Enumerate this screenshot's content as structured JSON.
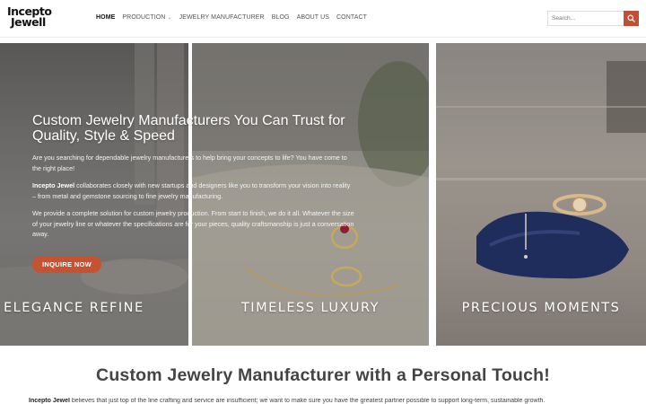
{
  "logo": {
    "line1": "Incepto",
    "line2": "Jewell"
  },
  "nav": {
    "items": [
      {
        "label": "HOME",
        "active": true
      },
      {
        "label": "PRODUCTION",
        "dropdown": true
      },
      {
        "label": "JEWELRY MANUFACTURER"
      },
      {
        "label": "BLOG"
      },
      {
        "label": "ABOUT US"
      },
      {
        "label": "CONTACT"
      }
    ]
  },
  "search": {
    "placeholder": "Search...",
    "icon": "search-icon",
    "button_color": "#c24f33"
  },
  "hero": {
    "title": "Custom Jewelry Manufacturers You Can Trust for Quality, Style & Speed",
    "p1": "Are you searching for dependable jewelry manufacturers to help bring your concepts to life? You have come to the right place!",
    "p2_brand": "Incepto Jewel",
    "p2_rest": " collaborates closely with new startups and designers like you to transform your vision into reality – from metal and gemstone sourcing to fine jewelry manufacturing.",
    "p3": "We provide a complete solution for custom jewelry production. From start to finish, we do it all. Whatever the size of your jewelry line or whatever the specifications are for your pieces, quality craftsmanship is just a conversation away.",
    "cta": "INQUIRE NOW",
    "cta_color": "#c55333",
    "panels": [
      {
        "caption": "ELEGANCE REFINE"
      },
      {
        "caption": "TIMELESS LUXURY"
      },
      {
        "caption": "PRECIOUS MOMENTS"
      }
    ]
  },
  "section": {
    "title": "Custom Jewelry Manufacturer with a Personal Touch!",
    "text_brand": "Incepto Jewel",
    "text_rest": " believes that just top of the line crafting and service are insufficient; we want to make sure you have the greatest partner possible to support long-term, sustainable growth."
  }
}
